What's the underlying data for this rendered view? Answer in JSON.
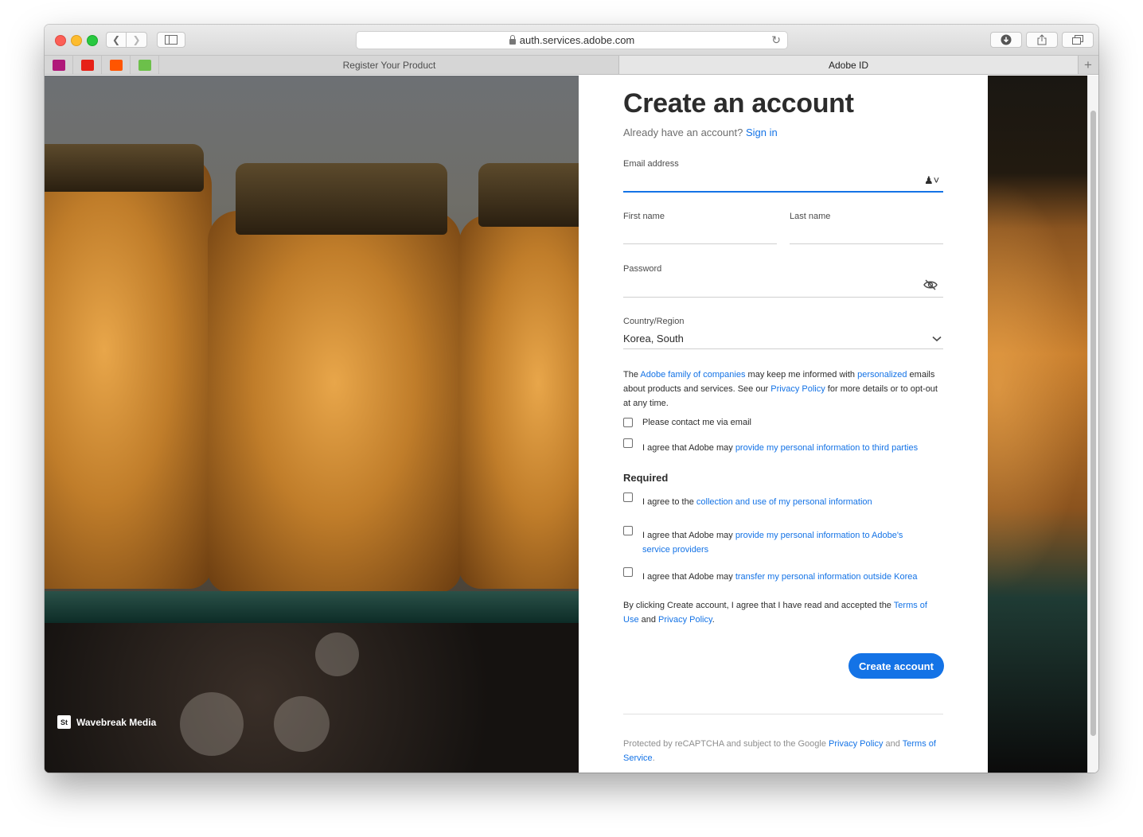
{
  "browser": {
    "url": "auth.services.adobe.com",
    "tabs": [
      {
        "label": "Register Your Product"
      },
      {
        "label": "Adobe ID"
      }
    ],
    "favorites": [
      {
        "icon": "vivaldi-icon",
        "color": "#b0197a"
      },
      {
        "icon": "youtube-icon",
        "color": "#e62117"
      },
      {
        "icon": "soundcloud-icon",
        "color": "#ff5500"
      },
      {
        "icon": "feedly-icon",
        "color": "#6cc04a"
      }
    ]
  },
  "photo": {
    "credit": "Wavebreak Media",
    "credit_badge": "St"
  },
  "form": {
    "title": "Create an account",
    "signin_prompt": "Already have an account?",
    "signin_link": "Sign in",
    "email_label": "Email address",
    "first_name_label": "First name",
    "last_name_label": "Last name",
    "password_label": "Password",
    "country_label": "Country/Region",
    "country_value": "Korea, South",
    "marketing": {
      "p1": "The ",
      "link1": "Adobe family of companies",
      "p2": " may keep me informed with ",
      "link2": "personalized",
      "p3": " emails about products and services. See our ",
      "link3": "Privacy Policy",
      "p4": " for more details or to opt-out at any time."
    },
    "optional_checks": [
      {
        "text": "Please contact me via email",
        "link": ""
      },
      {
        "text": "I agree that Adobe may ",
        "link": "provide my personal information to third parties"
      }
    ],
    "required_heading": "Required",
    "required_checks": [
      {
        "text": "I agree to the ",
        "link": "collection and use of my personal information"
      },
      {
        "text": "I agree that Adobe may ",
        "link": "provide my personal information to Adobe's service providers"
      },
      {
        "text": "I agree that Adobe may ",
        "link": "transfer my personal information outside Korea"
      }
    ],
    "terms": {
      "p1": "By clicking Create account, I agree that I have read and accepted the ",
      "link1": "Terms of Use",
      "p2": " and ",
      "link2": "Privacy Policy",
      "p3": "."
    },
    "submit_label": "Create account",
    "recaptcha": {
      "p1": "Protected by reCAPTCHA and subject to the Google ",
      "link1": "Privacy Policy",
      "p2": " and ",
      "link2": "Terms of Service",
      "p3": "."
    }
  },
  "colors": {
    "accent": "#1473e6"
  }
}
